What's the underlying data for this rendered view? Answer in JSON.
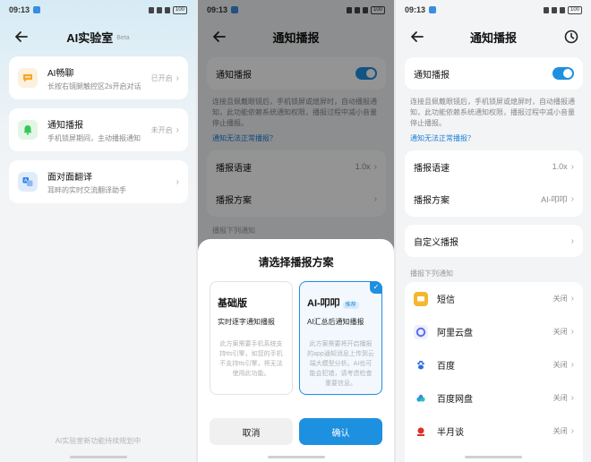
{
  "status": {
    "time": "09:13",
    "battery": "100"
  },
  "p1": {
    "title": "AI实验室",
    "beta": "Beta",
    "features": [
      {
        "title": "AI畅聊",
        "subtitle": "长按右镜腿触控区2s开启对话",
        "status": "已开启",
        "icon": "chat-bubble-icon",
        "color": "#f5a623"
      },
      {
        "title": "通知播报",
        "subtitle": "手机锁屏期间，主动播报通知",
        "status": "未开启",
        "icon": "bell-icon",
        "color": "#34c759"
      },
      {
        "title": "面对面翻译",
        "subtitle": "耳畔的实时交流翻译助手",
        "status": "",
        "icon": "translate-icon",
        "color": "#2f80ed"
      }
    ],
    "footer": "AI实验室新功能持续规划中"
  },
  "p2": {
    "title": "通知播报",
    "toggle_label": "通知播报",
    "desc": "连接且佩戴眼镜后，手机锁屏或熄屏时，自动播报通知，此功能依赖系统通知权限，播报过程中减小音量停止播报。",
    "link": "通知无法正常播报？",
    "speed_label": "播报语速",
    "speed_value": "1.0x",
    "scheme_label": "播报方案",
    "section": "播报下列通知",
    "sheet": {
      "title": "请选择播报方案",
      "basic_name": "基础版",
      "basic_sub": "实时逐字通知播报",
      "basic_desc": "此方案需要手机系统支持tts引擎，如您的手机不支持tts引擎，将无法使用此功能。",
      "ai_name": "AI-叩叩",
      "ai_tag": "推荐",
      "ai_sub": "AI汇总后通知播报",
      "ai_desc": "此方案需要将开启播报的app通知消息上传到云端大模型分析。AI也可能会犯错，请考虑检查重要信息。",
      "cancel": "取消",
      "confirm": "确认"
    }
  },
  "p3": {
    "title": "通知播报",
    "toggle_label": "通知播报",
    "desc": "连接且佩戴眼镜后，手机锁屏或熄屏时，自动播报通知，此功能依赖系统通知权限，播报过程中减小音量停止播报。",
    "link": "通知无法正常播报？",
    "speed_label": "播报语速",
    "speed_value": "1.0x",
    "scheme_label": "播报方案",
    "scheme_value": "AI-叩叩",
    "custom_label": "自定义播报",
    "section": "播报下列通知",
    "apps": [
      {
        "name": "短信",
        "status": "关闭",
        "icon": "sms-icon",
        "color": "#f5b730"
      },
      {
        "name": "阿里云盘",
        "status": "关闭",
        "icon": "aliyun-drive-icon",
        "color": "#5b6cf0"
      },
      {
        "name": "百度",
        "status": "关闭",
        "icon": "baidu-icon",
        "color": "#2e6be6"
      },
      {
        "name": "百度网盘",
        "status": "关闭",
        "icon": "baidu-netdisk-icon",
        "color": "#1fa3e8"
      },
      {
        "name": "半月谈",
        "status": "关闭",
        "icon": "banyuetan-icon",
        "color": "#d9322b"
      }
    ]
  }
}
